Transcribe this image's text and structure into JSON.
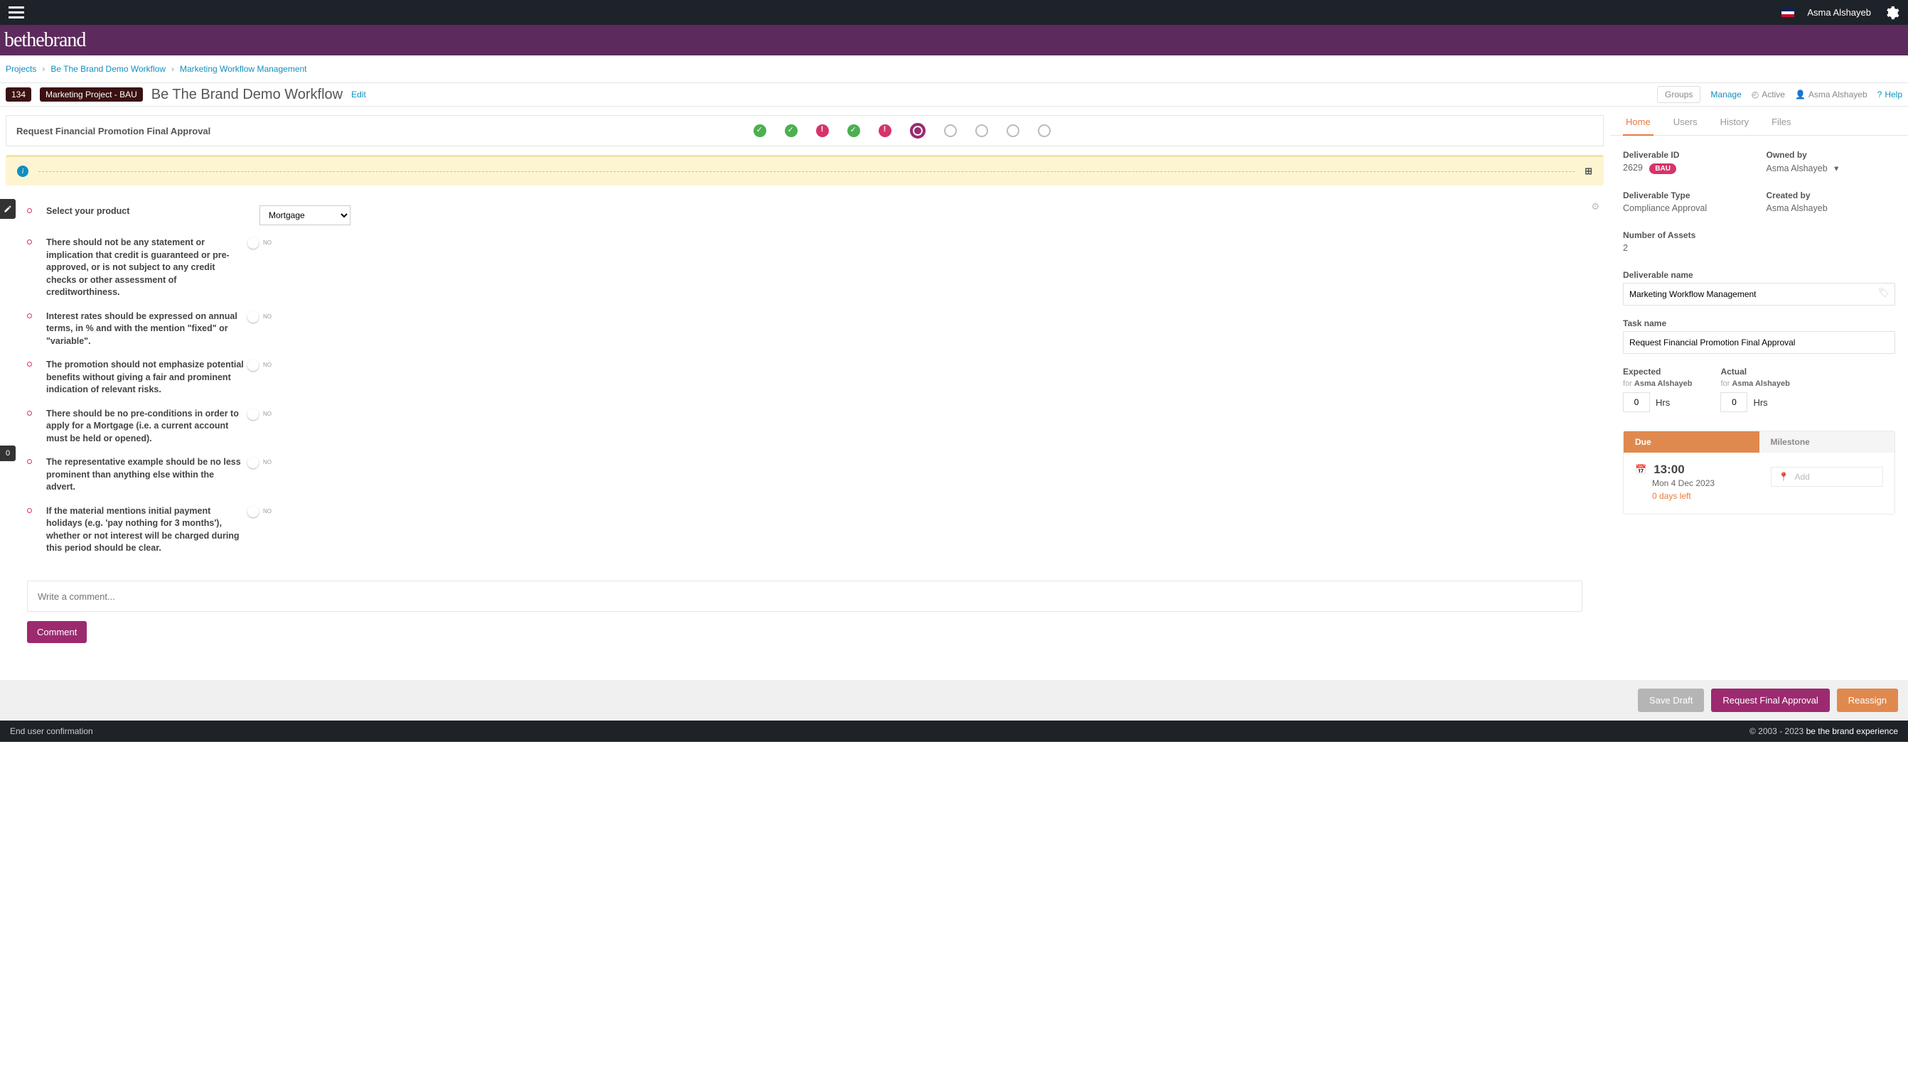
{
  "topbar": {
    "username": "Asma Alshayeb"
  },
  "brand": "bethebrand",
  "breadcrumb": {
    "projects": "Projects",
    "workflow": "Be The Brand Demo Workflow",
    "current": "Marketing Workflow Management"
  },
  "title": {
    "badge_num": "134",
    "badge_text": "Marketing Project - BAU",
    "text": "Be The Brand Demo Workflow",
    "edit": "Edit",
    "groups": "Groups",
    "manage": "Manage",
    "active": "Active",
    "owner": "Asma Alshayeb",
    "help": "Help"
  },
  "stage": {
    "title": "Request Financial Promotion Final Approval"
  },
  "form": {
    "product_label": "Select your product",
    "product_value": "Mortgage",
    "q1": "There should not be any statement or implication that credit is guaranteed or pre-approved, or is not subject to any credit checks or other assessment of creditworthiness.",
    "q2": "Interest rates should be expressed on annual terms, in % and with the mention \"fixed\" or \"variable\".",
    "q3": "The promotion should not emphasize potential benefits without giving a fair and prominent indication of relevant risks.",
    "q4": "There should be no pre-conditions in order to apply for a Mortgage (i.e. a current account must be held or opened).",
    "q5": "The representative example should be no less prominent than anything else within the advert.",
    "q6": "If the material mentions initial payment holidays (e.g. 'pay nothing for 3 months'), whether or not interest will be charged during this period should be clear."
  },
  "comment": {
    "placeholder": "Write a comment...",
    "button": "Comment"
  },
  "tabs": {
    "home": "Home",
    "users": "Users",
    "history": "History",
    "files": "Files"
  },
  "panel": {
    "deliverable_id_label": "Deliverable ID",
    "deliverable_id": "2629",
    "bau": "BAU",
    "owned_by_label": "Owned by",
    "owned_by": "Asma Alshayeb",
    "deliverable_type_label": "Deliverable Type",
    "deliverable_type": "Compliance Approval",
    "created_by_label": "Created by",
    "created_by": "Asma Alshayeb",
    "num_assets_label": "Number of Assets",
    "num_assets": "2",
    "deliverable_name_label": "Deliverable name",
    "deliverable_name": "Marketing Workflow Management",
    "task_name_label": "Task name",
    "task_name": "Request Financial Promotion Final Approval",
    "expected_label": "Expected",
    "actual_label": "Actual",
    "for_prefix": "for ",
    "for_user": "Asma Alshayeb",
    "expected_hrs": "0",
    "actual_hrs": "0",
    "hrs": "Hrs",
    "due_label": "Due",
    "milestone_label": "Milestone",
    "due_time": "13:00",
    "due_date": "Mon 4 Dec 2023",
    "due_left": "0 days left",
    "milestone_add": "Add"
  },
  "footer": {
    "save_draft": "Save Draft",
    "request_final": "Request Final Approval",
    "reassign": "Reassign"
  },
  "bottom": {
    "left": "End user confirmation",
    "copyright": "© 2003 - 2023 ",
    "brand": "be the brand experience"
  },
  "side_count": "0"
}
